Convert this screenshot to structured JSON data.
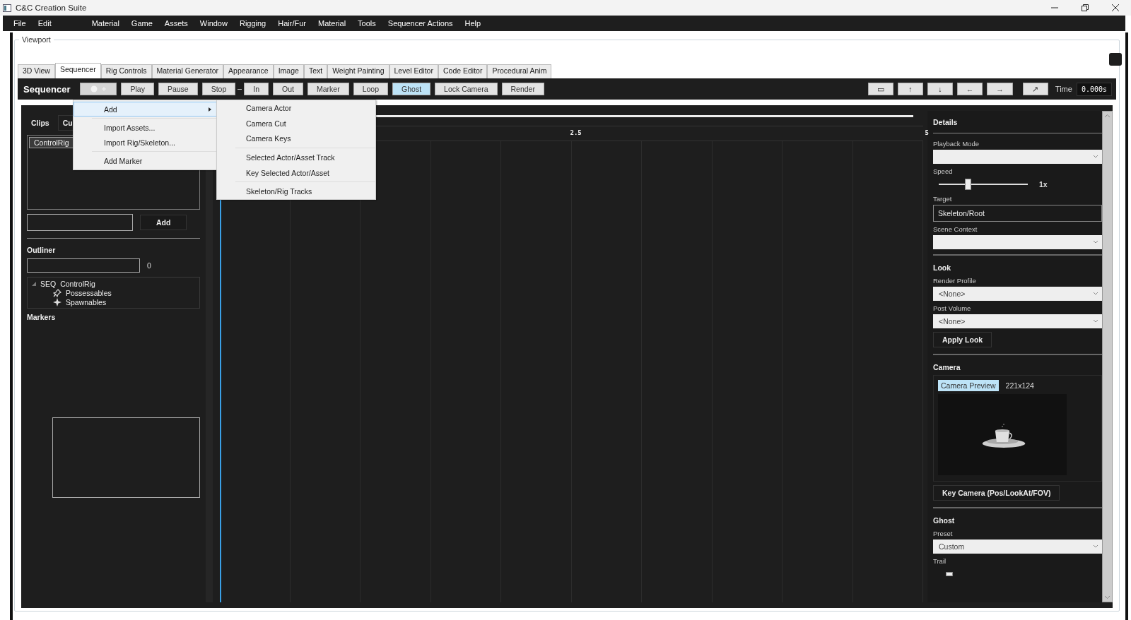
{
  "window": {
    "title": "C&C Creation Suite"
  },
  "menu_bar": [
    {
      "label": "File"
    },
    {
      "label": "Edit"
    },
    {
      "label": "Material"
    },
    {
      "label": "Game"
    },
    {
      "label": "Assets"
    },
    {
      "label": "Window"
    },
    {
      "label": "Rigging"
    },
    {
      "label": "Hair/Fur"
    },
    {
      "label": "Material"
    },
    {
      "label": "Tools"
    },
    {
      "label": "Sequencer Actions"
    },
    {
      "label": "Help"
    }
  ],
  "viewport": {
    "label": "Viewport"
  },
  "tabs": [
    {
      "label": "3D View",
      "selected": false
    },
    {
      "label": "Sequencer",
      "selected": true
    },
    {
      "label": "Rig Controls",
      "selected": false
    },
    {
      "label": "Material Generator",
      "selected": false
    },
    {
      "label": "Appearance",
      "selected": false
    },
    {
      "label": "Image",
      "selected": false
    },
    {
      "label": "Text",
      "selected": false
    },
    {
      "label": "Weight Painting",
      "selected": false
    },
    {
      "label": "Level Editor",
      "selected": false
    },
    {
      "label": "Code Editor",
      "selected": false
    },
    {
      "label": "Procedural Anim",
      "selected": false
    }
  ],
  "toolbar": {
    "title": "Sequencer",
    "buttons": [
      {
        "label": "Play",
        "selected": false
      },
      {
        "label": "Pause",
        "selected": false
      },
      {
        "label": "Stop",
        "selected": false
      },
      {
        "label": "In",
        "selected": false
      },
      {
        "label": "Out",
        "selected": false
      },
      {
        "label": "Marker",
        "selected": false
      },
      {
        "label": "Loop",
        "selected": false
      },
      {
        "label": "Ghost",
        "selected": true
      },
      {
        "label": "Lock Camera",
        "selected": false
      },
      {
        "label": "Render",
        "selected": false
      }
    ],
    "nav_buttons": [
      {
        "label": "▭"
      },
      {
        "label": "↑"
      },
      {
        "label": "↓"
      },
      {
        "label": "←"
      },
      {
        "label": "→"
      },
      {
        "label": "↗"
      }
    ],
    "time_label": "Time",
    "time_value": "0.000s"
  },
  "add_menu": {
    "items": [
      {
        "kind": "item",
        "label": "Add",
        "submenu": true,
        "selected": true
      },
      {
        "kind": "separator"
      },
      {
        "kind": "item",
        "label": "Import Assets...",
        "submenu": false,
        "selected": false
      },
      {
        "kind": "item",
        "label": "Import Rig/Skeleton...",
        "submenu": false,
        "selected": false
      },
      {
        "kind": "separator"
      },
      {
        "kind": "item",
        "label": "Add Marker",
        "submenu": false,
        "selected": false
      }
    ],
    "submenu": [
      {
        "kind": "item",
        "label": "Camera Actor"
      },
      {
        "kind": "item",
        "label": "Camera Cut"
      },
      {
        "kind": "item",
        "label": "Camera Keys"
      },
      {
        "kind": "separator"
      },
      {
        "kind": "item",
        "label": "Selected Actor/Asset Track"
      },
      {
        "kind": "item",
        "label": "Key Selected Actor/Asset"
      },
      {
        "kind": "separator"
      },
      {
        "kind": "item",
        "label": "Skeleton/Rig Tracks"
      }
    ]
  },
  "left_panel": {
    "tabs": [
      {
        "label": "Clips",
        "selected": true
      },
      {
        "label": "Cu",
        "selected": false
      }
    ],
    "clips": [
      {
        "label": "ControlRig",
        "selected": true
      }
    ],
    "add_button": "Add",
    "outliner": {
      "title": "Outliner",
      "count": "0",
      "tree": [
        {
          "tag": "SEQ",
          "label": "ControlRig",
          "expanded": true,
          "children": [
            {
              "kind": "possessables",
              "label": "Possessables"
            },
            {
              "kind": "spawnables",
              "label": "Spawnables"
            }
          ]
        }
      ]
    },
    "markers_title": "Markers"
  },
  "timeline": {
    "ruler": [
      {
        "label": "2.5"
      },
      {
        "label": "5"
      }
    ]
  },
  "details": {
    "title": "Details",
    "playback_mode": {
      "label": "Playback Mode"
    },
    "speed": {
      "label": "Speed",
      "level": 0.32,
      "reading": "1x"
    },
    "target": {
      "label": "Target",
      "value": "Skeleton/Root"
    },
    "scene_context": {
      "label": "Scene Context"
    },
    "look": {
      "title": "Look",
      "render_profile": {
        "label": "Render Profile",
        "value": "<None>"
      },
      "post_volume": {
        "label": "Post Volume",
        "value": "<None>"
      },
      "apply_button": "Apply Look"
    },
    "camera": {
      "title": "Camera",
      "preview_tab": {
        "label": "Camera Preview",
        "selected": true
      },
      "resolution": "221x124",
      "key_button": "Key Camera (Pos/LookAt/FOV)"
    },
    "ghost": {
      "title": "Ghost",
      "preset": {
        "label": "Preset",
        "value": "Custom"
      },
      "trail": {
        "label": "Trail",
        "level": 0.1
      }
    }
  }
}
